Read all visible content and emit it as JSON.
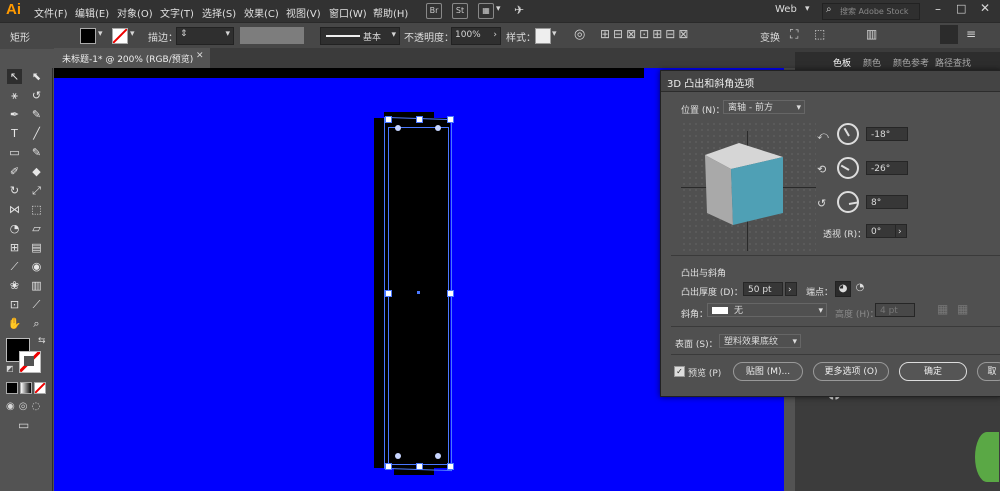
{
  "app": {
    "logo": "Ai"
  },
  "menubar": {
    "items": [
      "文件(F)",
      "编辑(E)",
      "对象(O)",
      "文字(T)",
      "选择(S)",
      "效果(C)",
      "视图(V)",
      "窗口(W)",
      "帮助(H)"
    ],
    "icons": {
      "br": "Br",
      "st": "St"
    },
    "workspace": "Web",
    "search_placeholder": "搜索 Adobe Stock"
  },
  "controlbar": {
    "object_type": "矩形",
    "stroke_label": "描边：",
    "stroke_style": "基本",
    "opacity_label": "不透明度：",
    "opacity_value": "100%",
    "style_label": "样式：",
    "transform_label": "变换"
  },
  "tabs": {
    "document": "未标题-1* @ 200% (RGB/预览)"
  },
  "right_panel": {
    "tabs": [
      "色板",
      "颜色",
      "颜色参考",
      "路径查找"
    ]
  },
  "dialog": {
    "title": "3D 凸出和斜角选项",
    "position_label": "位置 (N)：",
    "position_value": "离轴 - 前方",
    "rotation": {
      "x": "-18°",
      "y": "-26°",
      "z": "8°"
    },
    "perspective_label": "透视 (R)：",
    "perspective_value": "0°",
    "extrude_section": "凸出与斜角",
    "extrude_depth_label": "凸出厚度 (D)：",
    "extrude_depth_value": "50 pt",
    "cap_label": "端点：",
    "bevel_label": "斜角：",
    "bevel_value": "无",
    "height_label": "高度 (H)：",
    "height_value": "4 pt",
    "surface_label": "表面 (S)：",
    "surface_value": "塑料效果底纹",
    "preview_label": "预览 (P)",
    "preview_checked": true,
    "map_button": "贴图 (M)...",
    "more_options_button": "更多选项 (O)",
    "ok_button": "确定",
    "cancel_button": "取"
  },
  "colors": {
    "canvas": "#0000fe",
    "cube_side": "#4fa0b5",
    "cube_top": "#d6d6d6",
    "cube_left": "#a9a9a9",
    "selection": "#4a78ff",
    "illustrator_orange": "#ff9a00"
  }
}
